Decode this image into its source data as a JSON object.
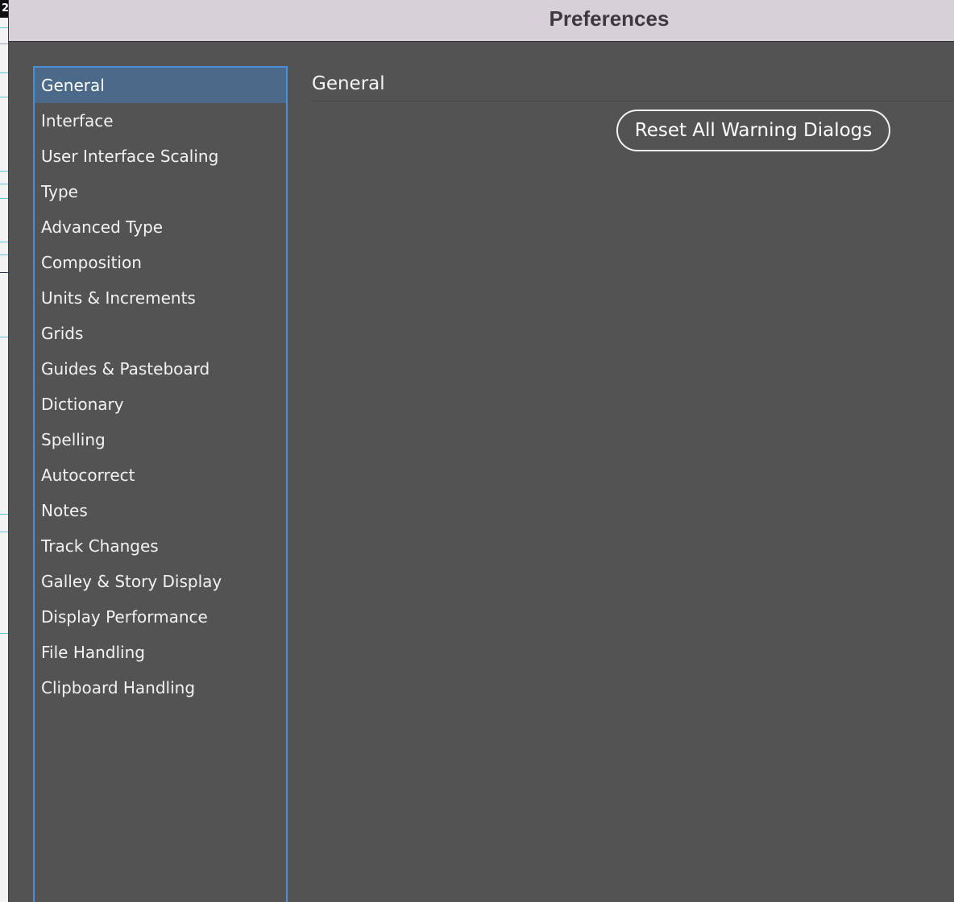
{
  "background_document": {
    "corner_label": "2"
  },
  "window": {
    "title": "Preferences"
  },
  "sidebar": {
    "selected_index": 0,
    "items": [
      {
        "label": "General"
      },
      {
        "label": "Interface"
      },
      {
        "label": "User Interface Scaling"
      },
      {
        "label": "Type"
      },
      {
        "label": "Advanced Type"
      },
      {
        "label": "Composition"
      },
      {
        "label": "Units & Increments"
      },
      {
        "label": "Grids"
      },
      {
        "label": "Guides & Pasteboard"
      },
      {
        "label": "Dictionary"
      },
      {
        "label": "Spelling"
      },
      {
        "label": "Autocorrect"
      },
      {
        "label": "Notes"
      },
      {
        "label": "Track Changes"
      },
      {
        "label": "Galley & Story Display"
      },
      {
        "label": "Display Performance"
      },
      {
        "label": "File Handling"
      },
      {
        "label": "Clipboard Handling"
      }
    ]
  },
  "main": {
    "section_title": "General",
    "reset_button_label": "Reset All Warning Dialogs"
  },
  "colors": {
    "dialog_background": "#535353",
    "title_bar": "#d8d0d8",
    "selection": "#4b6a89",
    "list_focus_border": "#4b8fd8"
  }
}
